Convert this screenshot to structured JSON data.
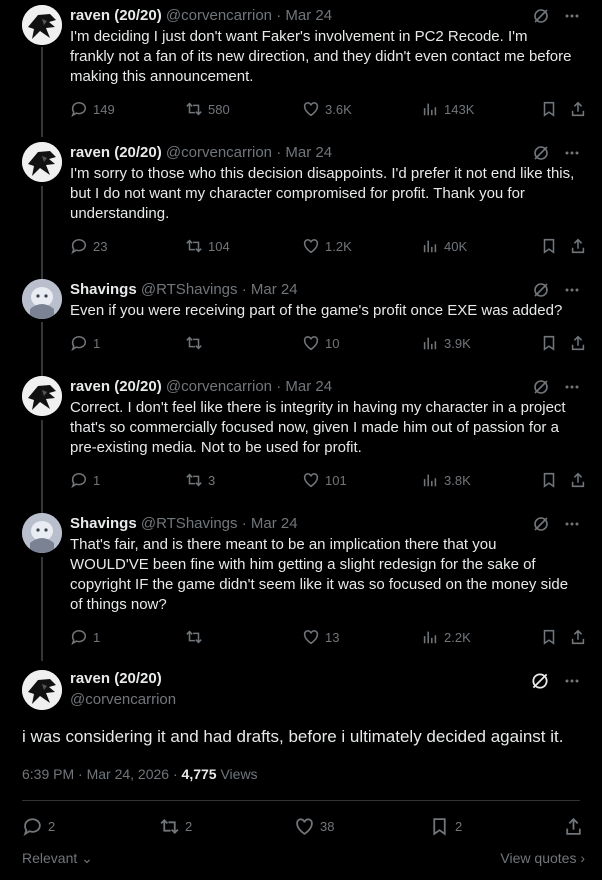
{
  "tweets": [
    {
      "name": "raven (20/20)",
      "handle": "@corvencarrion",
      "date": "· Mar 24",
      "text": "I'm deciding I just don't want Faker's involvement in PC2 Recode. I'm frankly not a fan of its new direction, and they didn't even contact me before making this announcement.",
      "replies": "149",
      "reposts": "580",
      "likes": "3.6K",
      "views": "143K"
    },
    {
      "name": "raven (20/20)",
      "handle": "@corvencarrion",
      "date": "· Mar 24",
      "text": "I'm sorry to those who this decision disappoints. I'd prefer it not end like this, but I do not want my character compromised for profit. Thank you for understanding.",
      "replies": "23",
      "reposts": "104",
      "likes": "1.2K",
      "views": "40K"
    },
    {
      "name": "Shavings",
      "handle": "@RTShavings",
      "date": "· Mar 24",
      "text": "Even if you were receiving part of the game's profit once EXE was added?",
      "replies": "1",
      "reposts": "",
      "likes": "10",
      "views": "3.9K"
    },
    {
      "name": "raven (20/20)",
      "handle": "@corvencarrion",
      "date": "· Mar 24",
      "text": "Correct. I don't feel like there is integrity in having my character in a project that's so commercially focused now, given I made him out of passion for a pre-existing media. Not to be used for profit.",
      "replies": "1",
      "reposts": "3",
      "likes": "101",
      "views": "3.8K"
    },
    {
      "name": "Shavings",
      "handle": "@RTShavings",
      "date": "· Mar 24",
      "text": "That's fair, and is there meant to be an implication there that you WOULD'VE been fine with him getting a slight redesign for the sake of copyright IF the game didn't seem like it was so focused on the money side of things now?",
      "replies": "1",
      "reposts": "",
      "likes": "13",
      "views": "2.2K"
    }
  ],
  "main": {
    "name": "raven (20/20)",
    "handle": "@corvencarrion",
    "text": "i was considering it and had drafts, before i ultimately decided against it.",
    "time": "6:39 PM · Mar 24, 2026 · ",
    "views_count": "4,775",
    "views_label": " Views",
    "replies": "2",
    "reposts": "2",
    "likes": "38",
    "bookmarks": "2"
  },
  "footer": {
    "relevant": "Relevant",
    "view_quotes": "View quotes"
  },
  "colors": {
    "background": "#000000",
    "text": "#e7e9ea",
    "muted": "#71767b",
    "divider": "#2f3336"
  }
}
